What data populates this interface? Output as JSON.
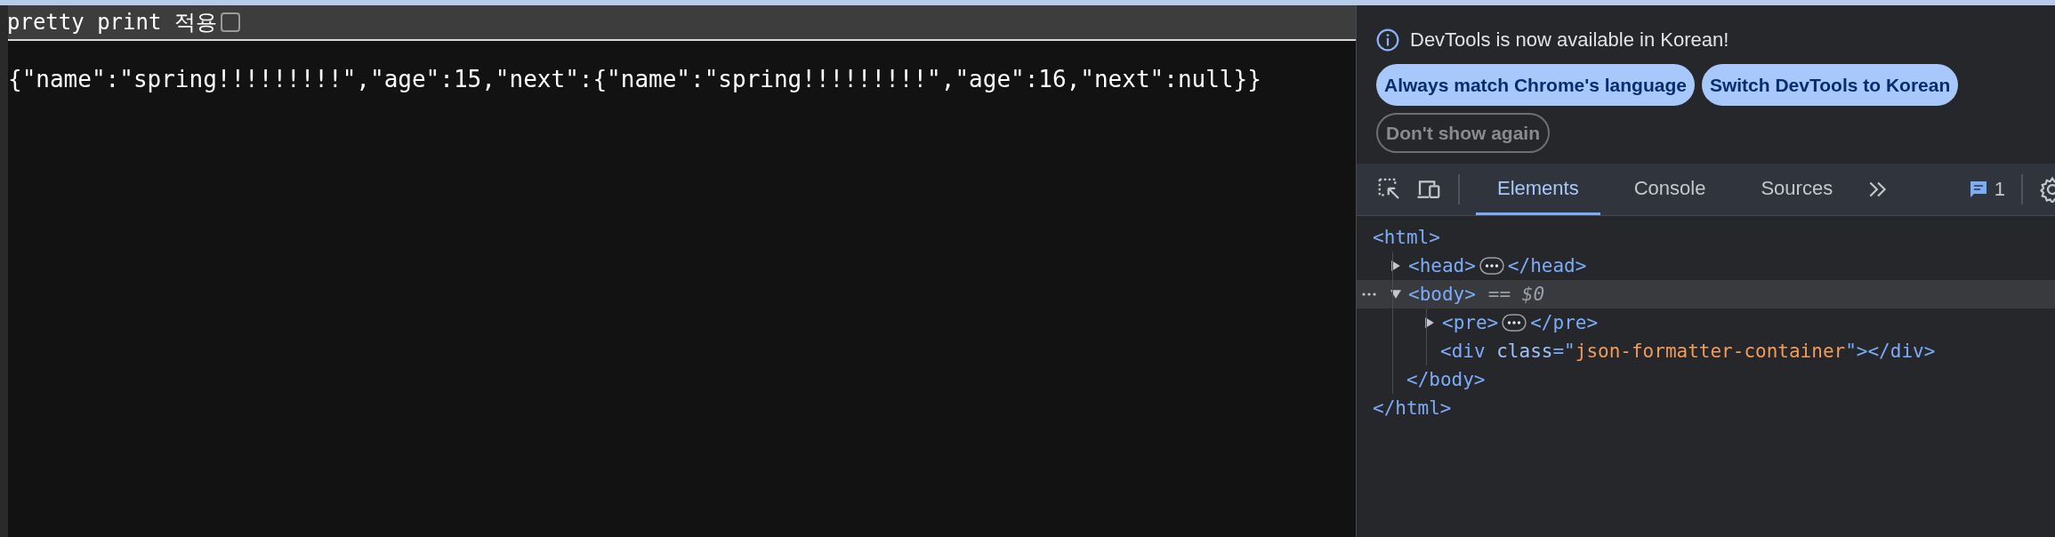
{
  "page": {
    "toolbar": {
      "label": "pretty print 적용",
      "checked": false
    },
    "json_text": "{\"name\":\"spring!!!!!!!!!\",\"age\":15,\"next\":{\"name\":\"spring!!!!!!!!!\",\"age\":16,\"next\":null}}"
  },
  "devtools": {
    "notice": "DevTools is now available in Korean!",
    "buttons": [
      {
        "label": "Always match Chrome's language",
        "kind": "primary"
      },
      {
        "label": "Switch DevTools to Korean",
        "kind": "primary"
      },
      {
        "label": "Don't show again",
        "kind": "outline"
      }
    ],
    "tabs": [
      {
        "label": "Elements",
        "selected": true
      },
      {
        "label": "Console",
        "selected": false
      },
      {
        "label": "Sources",
        "selected": false
      }
    ],
    "issues_count": "1",
    "tree": [
      {
        "kind": "root",
        "selected": false,
        "open": [
          {
            "text": "<html>",
            "kind": "tag"
          }
        ],
        "close": [
          {
            "text": "</html>",
            "kind": "tag"
          }
        ],
        "children": [
          {
            "kind": "element",
            "expanded": false,
            "selected": false,
            "open": [
              {
                "text": "<head>",
                "kind": "tag"
              }
            ],
            "close": [
              {
                "text": "</head>",
                "kind": "tag"
              }
            ]
          },
          {
            "kind": "element",
            "expanded": true,
            "selected": true,
            "open": [
              {
                "text": "<body>",
                "kind": "tag"
              }
            ],
            "suffix": "== $0",
            "close": [
              {
                "text": "</body>",
                "kind": "tag"
              }
            ],
            "children": [
              {
                "kind": "element",
                "expanded": false,
                "selected": false,
                "open": [
                  {
                    "text": "<pre>",
                    "kind": "tag"
                  }
                ],
                "close": [
                  {
                    "text": "</pre>",
                    "kind": "tag"
                  }
                ]
              },
              {
                "kind": "leaf",
                "selected": false,
                "open": [
                  {
                    "text": "<div",
                    "kind": "tag"
                  },
                  {
                    "text": " class",
                    "kind": "attr"
                  },
                  {
                    "text": "=\"",
                    "kind": "tag"
                  },
                  {
                    "text": "json-formatter-container",
                    "kind": "value"
                  },
                  {
                    "text": "\"></div>",
                    "kind": "tag"
                  }
                ]
              }
            ]
          }
        ]
      }
    ]
  }
}
